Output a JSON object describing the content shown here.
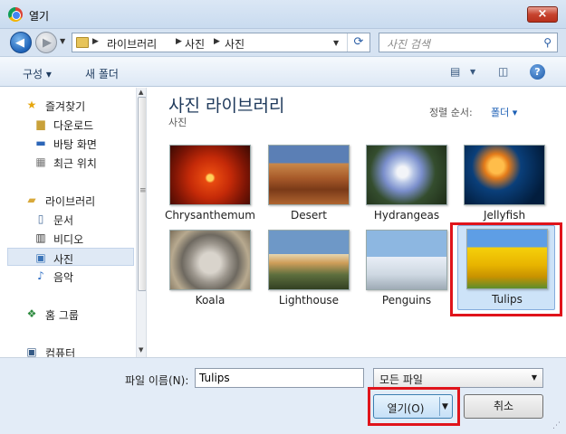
{
  "window": {
    "title": "열기",
    "close_label": "×"
  },
  "address": {
    "crumbs": [
      "라이브러리",
      "사진",
      "사진"
    ],
    "search_placeholder": "사진 검색"
  },
  "toolbar": {
    "organize_label": "구성 ▾",
    "new_folder_label": "새 폴더",
    "help_label": "?"
  },
  "sidebar": {
    "items": [
      {
        "label": "즐겨찾기",
        "icon": "star-icon"
      },
      {
        "label": "다운로드",
        "icon": "downloads-folder-icon"
      },
      {
        "label": "바탕 화면",
        "icon": "desktop-icon"
      },
      {
        "label": "최근 위치",
        "icon": "recent-places-icon"
      },
      {
        "label": "라이브러리",
        "icon": "library-icon"
      },
      {
        "label": "문서",
        "icon": "documents-icon"
      },
      {
        "label": "비디오",
        "icon": "video-icon"
      },
      {
        "label": "사진",
        "icon": "pictures-icon"
      },
      {
        "label": "음악",
        "icon": "music-icon"
      },
      {
        "label": "홈 그룹",
        "icon": "homegroup-icon"
      },
      {
        "label": "컴퓨터",
        "icon": "computer-icon"
      }
    ],
    "selected": "사진"
  },
  "main": {
    "title": "사진 라이브러리",
    "subtitle": "사진",
    "arrange_label": "정렬 순서:",
    "arrange_value": "폴더 ▾",
    "files": [
      "Chrysanthemum",
      "Desert",
      "Hydrangeas",
      "Jellyfish",
      "Koala",
      "Lighthouse",
      "Penguins",
      "Tulips"
    ],
    "selected_file": "Tulips"
  },
  "bottom": {
    "filename_label": "파일 이름(N):",
    "filename_value": "Tulips",
    "filetype_value": "모든 파일",
    "open_label": "열기(O)",
    "cancel_label": "취소"
  },
  "colors": {
    "highlight": "#e0141b",
    "accent": "#1e395b"
  }
}
